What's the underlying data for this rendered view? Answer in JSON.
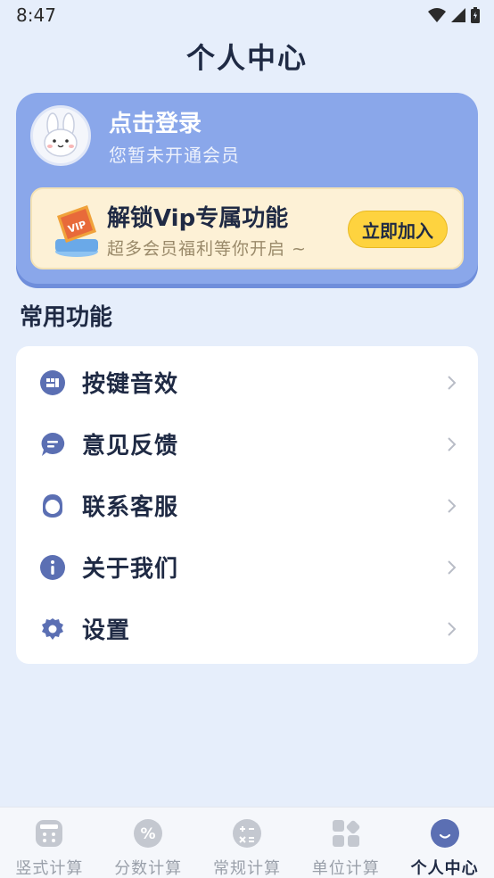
{
  "status_bar": {
    "time": "8:47"
  },
  "header": {
    "title": "个人中心"
  },
  "profile": {
    "login_title": "点击登录",
    "member_status": "您暂未开通会员",
    "vip": {
      "title": "解锁Vip专属功能",
      "subtitle": "超多会员福利等你开启 ~",
      "join_label": "立即加入",
      "badge_text": "VIP"
    }
  },
  "section": {
    "title": "常用功能"
  },
  "menu": {
    "items": [
      {
        "label": "按键音效",
        "icon": "keypad-icon"
      },
      {
        "label": "意见反馈",
        "icon": "chat-bubble-icon"
      },
      {
        "label": "联系客服",
        "icon": "headset-icon"
      },
      {
        "label": "关于我们",
        "icon": "info-icon"
      },
      {
        "label": "设置",
        "icon": "gear-icon"
      }
    ]
  },
  "bottom_nav": {
    "items": [
      {
        "label": "竖式计算",
        "icon": "calculator-icon"
      },
      {
        "label": "分数计算",
        "icon": "percent-icon"
      },
      {
        "label": "常规计算",
        "icon": "operators-icon"
      },
      {
        "label": "单位计算",
        "icon": "grid-icon"
      },
      {
        "label": "个人中心",
        "icon": "smile-icon"
      }
    ],
    "active_index": 4
  },
  "colors": {
    "accent": "#8aa7ea",
    "icon": "#5b6fb3",
    "vip_button": "#fed33f",
    "background": "#e6eefb"
  }
}
